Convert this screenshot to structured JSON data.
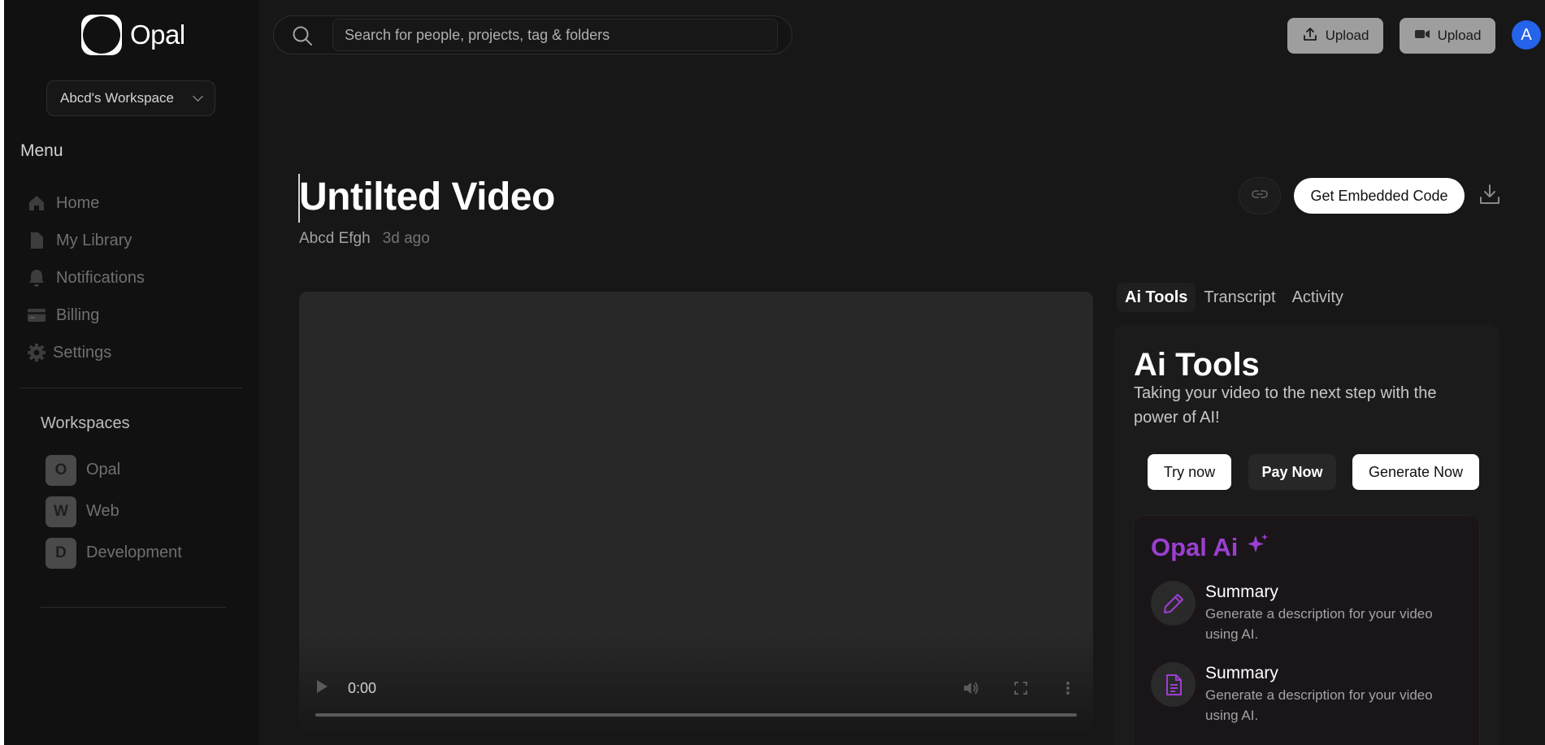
{
  "sidebar": {
    "logo_text": "Opal",
    "workspace_select": "Abcd's Workspace",
    "menu_title": "Menu",
    "items": [
      {
        "label": "Home",
        "icon": "home-icon"
      },
      {
        "label": "My Library",
        "icon": "document-icon"
      },
      {
        "label": "Notifications",
        "icon": "bell-icon"
      },
      {
        "label": "Billing",
        "icon": "credit-card-icon"
      },
      {
        "label": "Settings",
        "icon": "gear-icon"
      }
    ],
    "workspaces_title": "Workspaces",
    "workspaces": [
      {
        "badge": "O",
        "label": "Opal"
      },
      {
        "badge": "W",
        "label": "Web"
      },
      {
        "badge": "D",
        "label": "Development"
      }
    ]
  },
  "header": {
    "search_placeholder": "Search for people, projects, tag & folders",
    "upload_label": "Upload",
    "record_upload_label": "Upload",
    "avatar_initial": "A"
  },
  "video": {
    "title": "Untilted Video",
    "author": "Abcd Efgh",
    "date": "3d ago",
    "embed_label": "Get Embedded Code",
    "player_time": "0:00"
  },
  "panel": {
    "tabs": [
      "Ai Tools",
      "Transcript",
      "Activity"
    ],
    "active_tab": "Ai Tools",
    "title": "Ai Tools",
    "subtitle": "Taking your video to the next step with the power of AI!",
    "buttons": [
      "Try now",
      "Pay Now",
      "Generate Now"
    ],
    "ai_card": {
      "title": "Opal Ai",
      "items": [
        {
          "title": "Summary",
          "description": "Generate a description for your video using AI.",
          "icon": "pencil-icon"
        },
        {
          "title": "Summary",
          "description": "Generate a description for your video using AI.",
          "icon": "file-text-icon"
        }
      ]
    }
  },
  "colors": {
    "background": "#171717",
    "sidebar": "#111111",
    "accent_purple": "#9b3fd0",
    "avatar_blue": "#2563eb",
    "upload_button": "#9e9e9e"
  }
}
